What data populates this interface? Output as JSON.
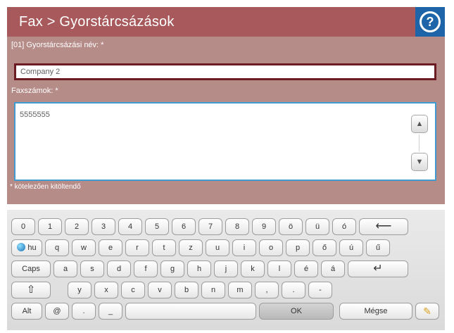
{
  "header": {
    "title": "Fax > Gyorstárcsázások",
    "help_symbol": "?"
  },
  "form": {
    "name_label": "[01] Gyorstárcsázási név: *",
    "name_value": "Company 2",
    "fax_label": "Faxszámok: *",
    "fax_value": "5555555",
    "required_note": "* kötelezően kitöltendő"
  },
  "keyboard": {
    "row1": [
      "0",
      "1",
      "2",
      "3",
      "4",
      "5",
      "6",
      "7",
      "8",
      "9",
      "ö",
      "ü",
      "ó"
    ],
    "backspace": "⟵",
    "lang": "hu",
    "row2": [
      "q",
      "w",
      "e",
      "r",
      "t",
      "z",
      "u",
      "i",
      "o",
      "p",
      "ő",
      "ú",
      "ű"
    ],
    "caps": "Caps",
    "row3": [
      "a",
      "s",
      "d",
      "f",
      "g",
      "h",
      "j",
      "k",
      "l",
      "é",
      "á"
    ],
    "enter": "↵",
    "shift": "⇧",
    "row4": [
      "y",
      "x",
      "c",
      "v",
      "b",
      "n",
      "m",
      ",",
      ".",
      "-"
    ],
    "alt": "Alt",
    "at": "@",
    "dot": ".",
    "underscore": "_",
    "ok": "OK",
    "cancel": "Mégse",
    "edit_icon": "pencil-icon"
  },
  "colors": {
    "header": "#a7595b",
    "help": "#1d65a8",
    "form_panel": "#b68c89",
    "name_border": "#6b1c22",
    "fax_border": "#3f9ad0"
  }
}
